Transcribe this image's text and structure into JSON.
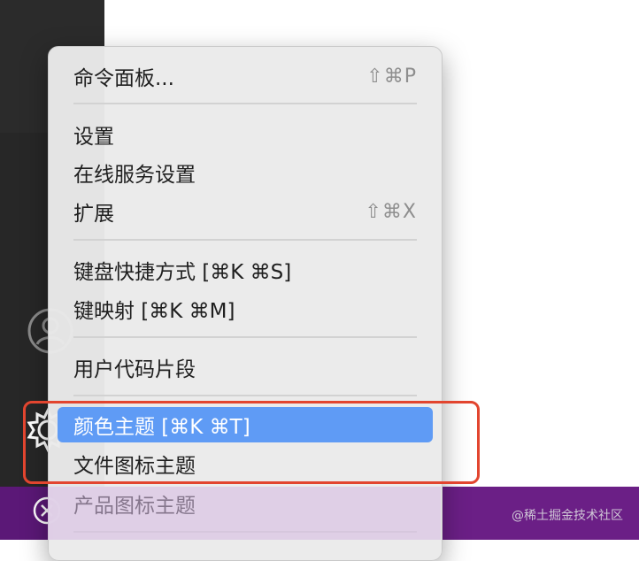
{
  "menu": {
    "items": [
      {
        "label": "命令面板...",
        "shortcut": "⇧⌘P"
      },
      {
        "label": "设置",
        "shortcut": ""
      },
      {
        "label": "在线服务设置",
        "shortcut": ""
      },
      {
        "label": "扩展",
        "shortcut": "⇧⌘X"
      },
      {
        "label": "键盘快捷方式 [⌘K ⌘S]",
        "shortcut": ""
      },
      {
        "label": "键映射 [⌘K ⌘M]",
        "shortcut": ""
      },
      {
        "label": "用户代码片段",
        "shortcut": ""
      },
      {
        "label": "颜色主题 [⌘K ⌘T]",
        "shortcut": ""
      },
      {
        "label": "文件图标主题",
        "shortcut": ""
      },
      {
        "label": "产品图标主题",
        "shortcut": ""
      }
    ],
    "selected_index": 7
  },
  "watermark": "@稀土掘金技术社区",
  "colors": {
    "selected": "#5f9bf5",
    "annotation_border": "#e2452f",
    "status_bar": "#6b1f86"
  },
  "icons": [
    "account-icon",
    "gear-icon",
    "remote-icon"
  ]
}
